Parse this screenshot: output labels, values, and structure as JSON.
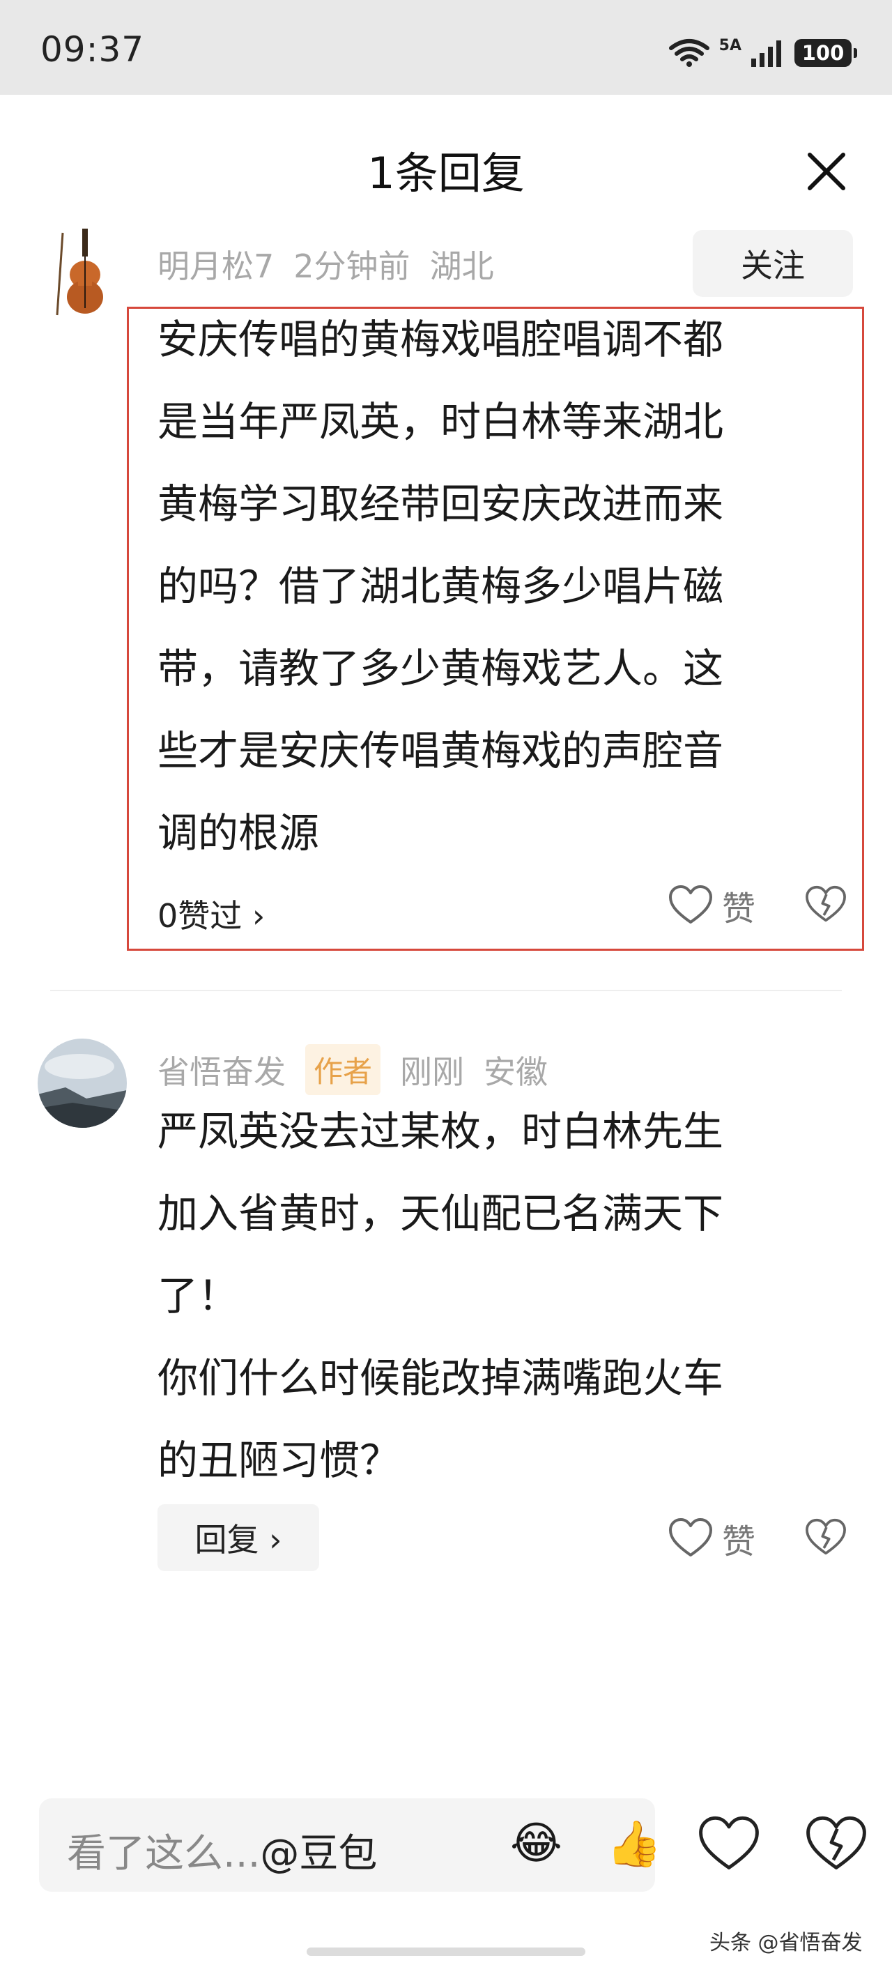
{
  "status_bar": {
    "time": "09:37",
    "network": "5A",
    "battery": "100"
  },
  "header": {
    "title": "1条回复"
  },
  "main_comment": {
    "author": "明月松7",
    "time": "2分钟前",
    "location": "湖北",
    "follow_label": "关注",
    "lines": [
      "安庆传唱的黄梅戏唱腔唱调不都",
      "是当年严凤英，时白林等来湖北",
      "黄梅学习取经带回安庆改进而来",
      "的吗？借了湖北黄梅多少唱片磁",
      "带，请教了多少黄梅戏艺人。这",
      "些才是安庆传唱黄梅戏的声腔音",
      "调的根源"
    ],
    "likes_label": "0赞过 ›",
    "like_label": "赞"
  },
  "reply": {
    "author": "省悟奋发",
    "author_tag": "作者",
    "time": "刚刚",
    "location": "安徽",
    "lines": [
      "严凤英没去过某枚，时白林先生",
      "加入省黄时，天仙配已名满天下",
      "了！",
      "你们什么时候能改掉满嘴跑火车",
      "的丑陋习惯？"
    ],
    "reply_label": "回复 ›",
    "like_label": "赞"
  },
  "bottom_bar": {
    "input_placeholder": "看了这么...",
    "mention": "@豆包",
    "emoji_1": "😂",
    "emoji_2": "👍"
  },
  "watermark": "头条 @省悟奋发",
  "colors": {
    "highlight_border": "#d6483c",
    "author_tag_bg": "#fdf2e2",
    "author_tag_text": "#e7a24a",
    "meta_gray": "#a8a8a8"
  }
}
